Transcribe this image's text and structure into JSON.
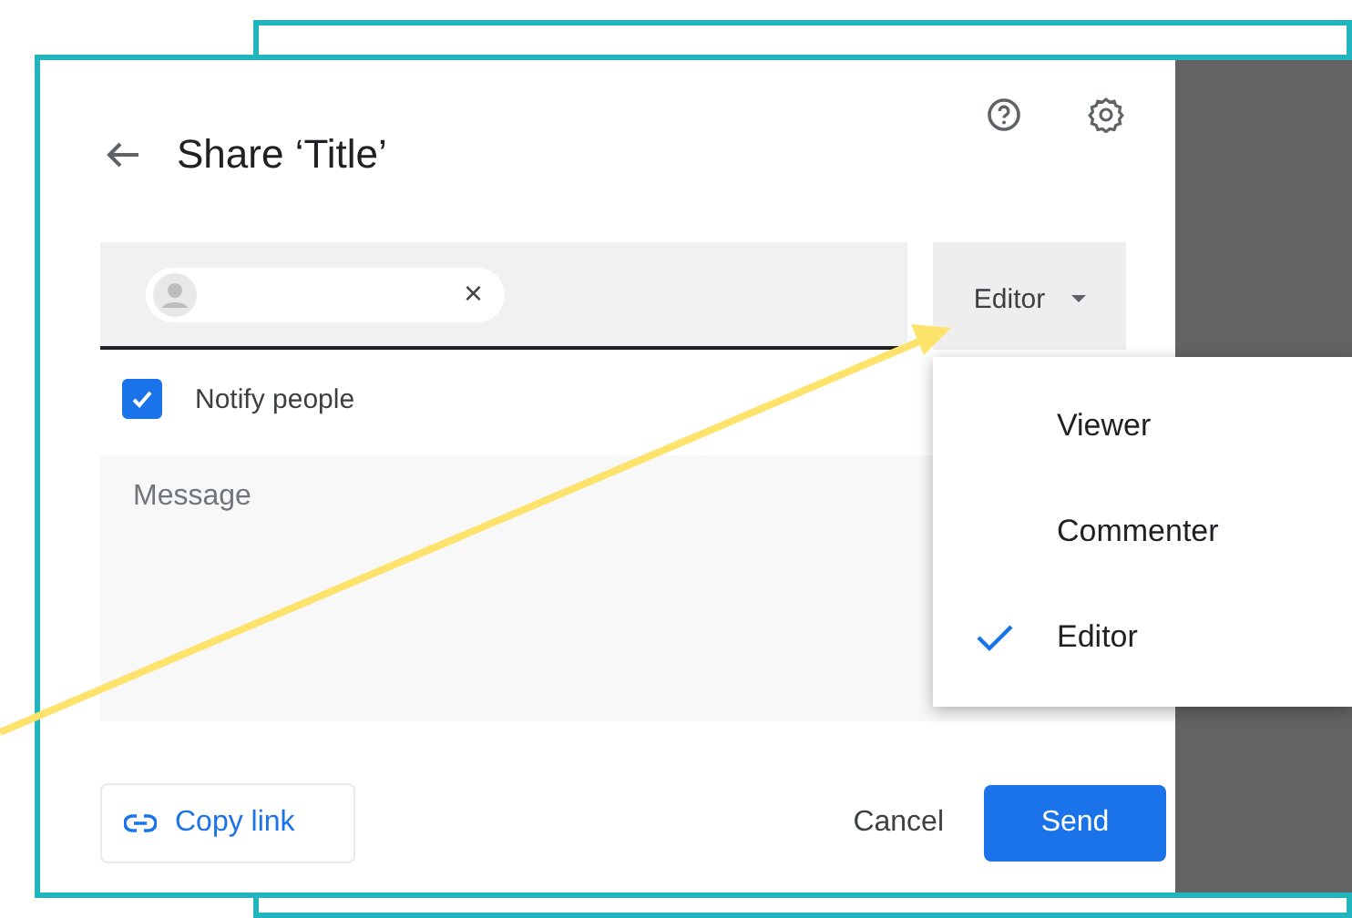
{
  "dialog": {
    "title": "Share ‘Title’"
  },
  "recipient_chip": {
    "remove_symbol": "×"
  },
  "role_button": {
    "label": "Editor"
  },
  "notify": {
    "label": "Notify people",
    "checked": true
  },
  "message": {
    "placeholder": "Message"
  },
  "role_menu": [
    {
      "label": "Viewer",
      "selected": false
    },
    {
      "label": "Commenter",
      "selected": false
    },
    {
      "label": "Editor",
      "selected": true
    }
  ],
  "footer": {
    "copy_link": "Copy link",
    "cancel": "Cancel",
    "send": "Send"
  }
}
